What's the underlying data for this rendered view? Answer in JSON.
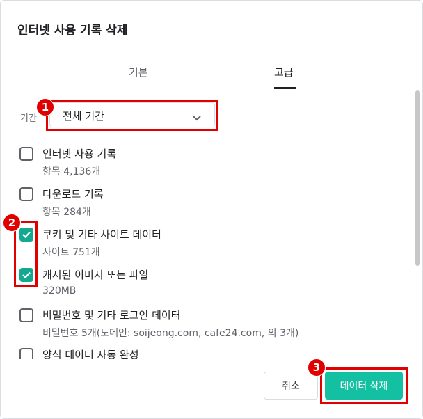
{
  "dialog": {
    "title": "인터넷 사용 기록 삭제",
    "tabs": [
      {
        "label": "기본",
        "selected": false
      },
      {
        "label": "고급",
        "selected": true
      }
    ],
    "time_range": {
      "label": "기간",
      "value": "전체 기간"
    },
    "items": [
      {
        "title": "인터넷 사용 기록",
        "subtitle": "항목 4,136개",
        "checked": false
      },
      {
        "title": "다운로드 기록",
        "subtitle": "항목 284개",
        "checked": false
      },
      {
        "title": "쿠키 및 기타 사이트 데이터",
        "subtitle": "사이트 751개",
        "checked": true
      },
      {
        "title": "캐시된 이미지 또는 파일",
        "subtitle": "320MB",
        "checked": true
      },
      {
        "title": "비밀번호 및 기타 로그인 데이터",
        "subtitle": "비밀번호 5개(도메인: soijeong.com, cafe24.com, 외 3개)",
        "checked": false
      },
      {
        "title": "양식 데이터 자동 완성",
        "subtitle": "",
        "checked": false
      }
    ],
    "buttons": {
      "cancel": "취소",
      "delete": "데이터 삭제"
    },
    "accent_color": "#13c0a2"
  },
  "annotations": {
    "badge1": "1",
    "badge2": "2",
    "badge3": "3",
    "highlight_color": "#e00000"
  }
}
